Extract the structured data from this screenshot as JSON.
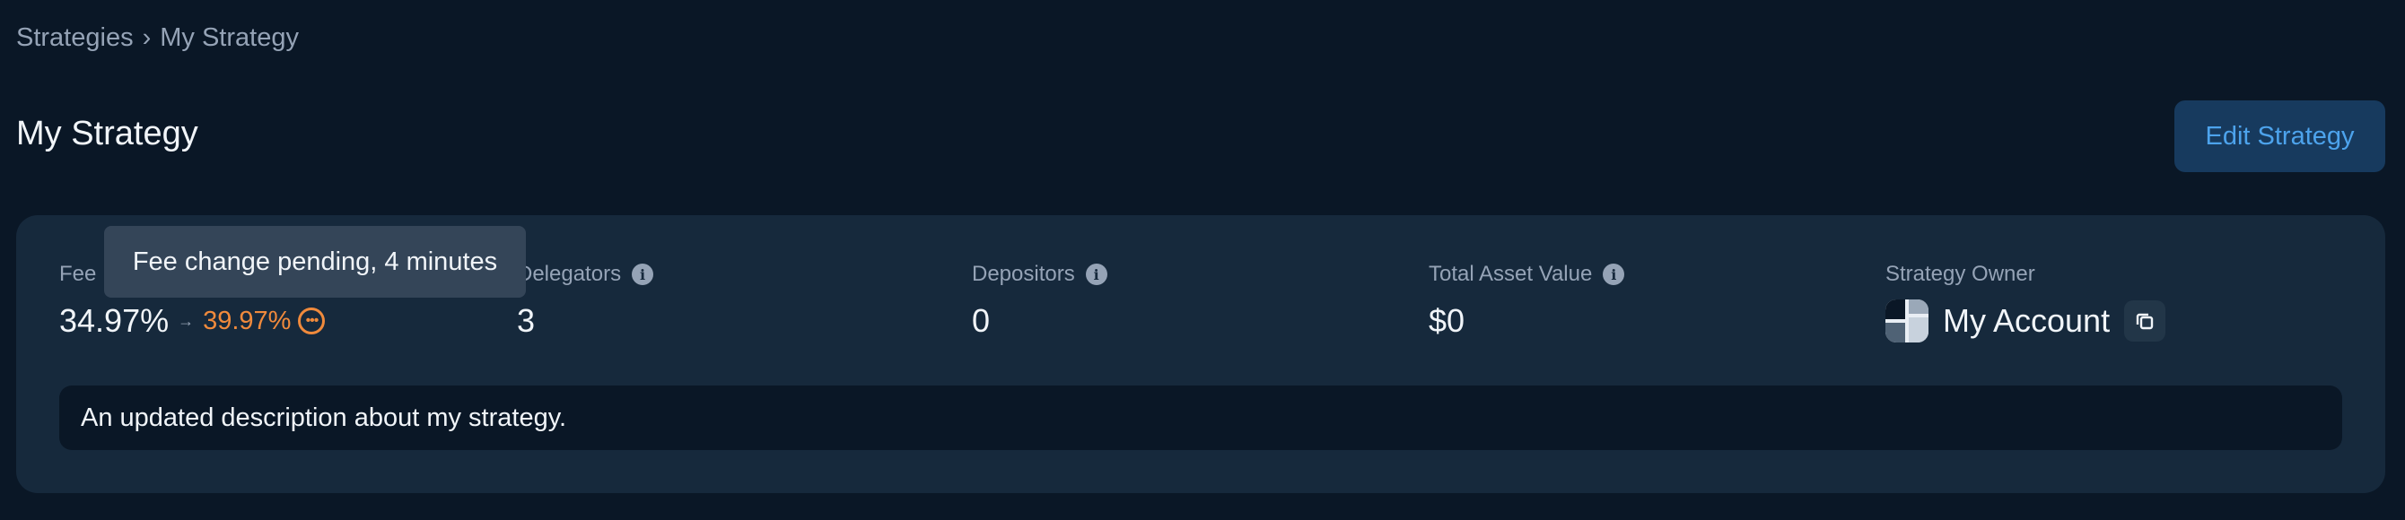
{
  "breadcrumb": {
    "items": [
      "Strategies",
      "My Strategy"
    ],
    "separator": "›"
  },
  "page_title": "My Strategy",
  "edit_button_label": "Edit Strategy",
  "stats": {
    "fee": {
      "label": "Fee",
      "current": "34.97%",
      "arrow": "→",
      "pending": "39.97%",
      "pending_icon": "more-horizontal-circle-icon"
    },
    "delegators": {
      "label": "Delegators",
      "value": "3"
    },
    "depositors": {
      "label": "Depositors",
      "value": "0"
    },
    "total_asset_value": {
      "label": "Total Asset Value",
      "value": "$0"
    },
    "owner": {
      "label": "Strategy Owner",
      "value": "My Account"
    }
  },
  "description": "An updated description about my strategy.",
  "tooltip": "Fee change pending, 4 minutes",
  "colors": {
    "background": "#0a1726",
    "card": "#16293c",
    "accent": "#4da3ec",
    "pending": "#f08a3c"
  }
}
